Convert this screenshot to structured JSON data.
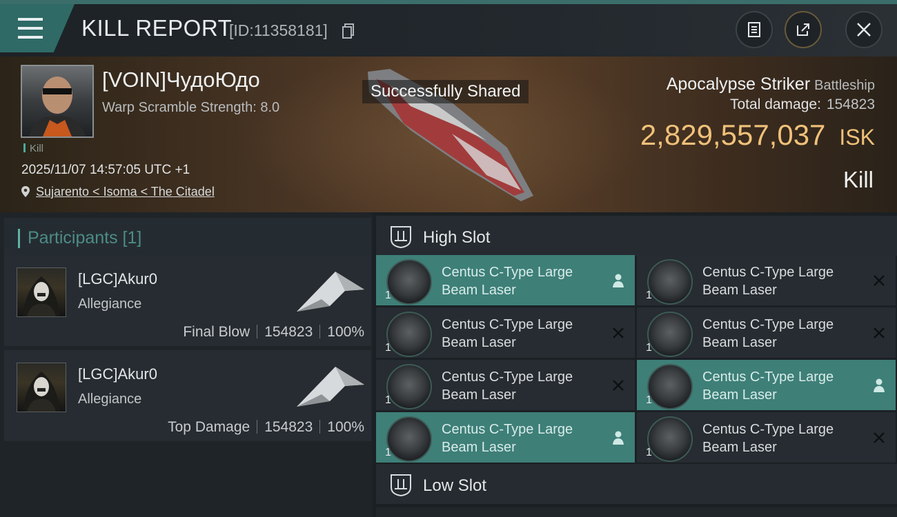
{
  "header": {
    "title": "KILL REPORT",
    "report_id": "[ID:11358181]"
  },
  "victim": {
    "name": "[VOIN]ЧудоЮдо",
    "warp_scramble": "Warp Scramble Strength: 8.0",
    "tag": "Kill",
    "datetime": "2025/11/07 14:57:05 UTC +1",
    "location": "Sujarento < Isoma < The Citadel",
    "ship_name": "Apocalypse Striker",
    "ship_class": "Battleship",
    "total_damage_label": "Total damage:",
    "total_damage_value": "154823",
    "isk_value": "2,829,557,037",
    "isk_unit": "ISK",
    "result": "Kill"
  },
  "toast": "Successfully Shared",
  "participants": {
    "header": "Participants [1]",
    "rows": [
      {
        "name": "[LGC]Akur0",
        "corp": "Allegiance",
        "role": "Final Blow",
        "damage": "154823",
        "percent": "100%"
      },
      {
        "name": "[LGC]Akur0",
        "corp": "Allegiance",
        "role": "Top Damage",
        "damage": "154823",
        "percent": "100%"
      }
    ]
  },
  "high_slot": {
    "label": "High Slot",
    "modules": [
      {
        "name": "Centus C-Type Large Beam Laser",
        "qty": "1",
        "status": "dropped"
      },
      {
        "name": "Centus C-Type Large Beam Laser",
        "qty": "1",
        "status": "destroyed"
      },
      {
        "name": "Centus C-Type Large Beam Laser",
        "qty": "1",
        "status": "destroyed"
      },
      {
        "name": "Centus C-Type Large Beam Laser",
        "qty": "1",
        "status": "destroyed"
      },
      {
        "name": "Centus C-Type Large Beam Laser",
        "qty": "1",
        "status": "destroyed"
      },
      {
        "name": "Centus C-Type Large Beam Laser",
        "qty": "1",
        "status": "dropped"
      },
      {
        "name": "Centus C-Type Large Beam Laser",
        "qty": "1",
        "status": "dropped"
      },
      {
        "name": "Centus C-Type Large Beam Laser",
        "qty": "1",
        "status": "destroyed"
      }
    ]
  },
  "low_slot": {
    "label": "Low Slot"
  },
  "colors": {
    "accent": "#3e7f78",
    "isk": "#f0c17a",
    "teal_bar": "#3b6e6a"
  }
}
